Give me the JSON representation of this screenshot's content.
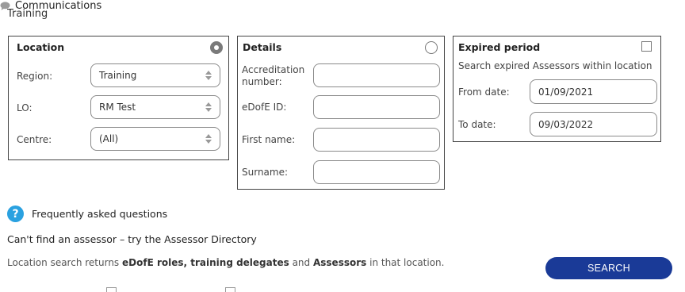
{
  "header": {
    "page_title": "Training",
    "communications_label": "Communications"
  },
  "location_panel": {
    "title": "Location",
    "selected": true,
    "fields": [
      {
        "label": "Region:",
        "value": "Training"
      },
      {
        "label": "LO:",
        "value": "RM Test"
      },
      {
        "label": "Centre:",
        "value": "(All)"
      }
    ]
  },
  "details_panel": {
    "title": "Details",
    "selected": false,
    "fields": [
      {
        "label": "Accreditation number:",
        "value": ""
      },
      {
        "label": "eDofE ID:",
        "value": ""
      },
      {
        "label": "First name:",
        "value": ""
      },
      {
        "label": "Surname:",
        "value": ""
      }
    ]
  },
  "expired_panel": {
    "title": "Expired period",
    "checked": false,
    "description": "Search expired Assessors within location",
    "from_label": "From date:",
    "from_value": "01/09/2021",
    "to_label": "To date:",
    "to_value": "09/03/2022"
  },
  "faq": {
    "icon_glyph": "?",
    "label": "Frequently asked questions"
  },
  "directory_link": "Can't find an assessor – try the Assessor Directory",
  "info": {
    "prefix": "Location search returns ",
    "b1": "eDofE roles, training delegates",
    "mid1": " and ",
    "b2": "Assessors",
    "suffix": " in that location."
  },
  "search_button": "SEARCH",
  "colors": {
    "search_button_bg": "#1a3a97",
    "faq_icon_bg": "#2aa1e0"
  }
}
